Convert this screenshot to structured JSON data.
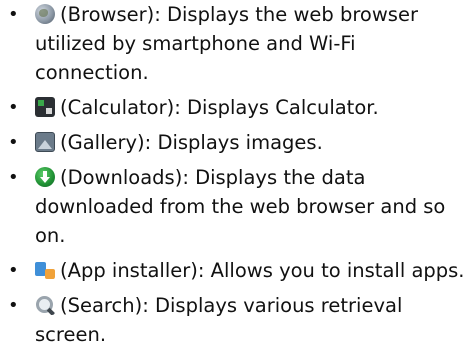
{
  "items": [
    {
      "icon": "browser-icon",
      "name": "(Browser)",
      "desc": ": Displays the web browser utilized by smartphone and Wi-Fi connection."
    },
    {
      "icon": "calculator-icon",
      "name": "(Calculator)",
      "desc": ": Displays Calculator."
    },
    {
      "icon": "gallery-icon",
      "name": "(Gallery)",
      "desc": ": Displays images."
    },
    {
      "icon": "downloads-icon",
      "name": "(Downloads)",
      "desc": ": Displays the data downloaded from the web browser and so on."
    },
    {
      "icon": "app-installer-icon",
      "name": "(App installer)",
      "desc": ": Allows you to install apps."
    },
    {
      "icon": "search-icon",
      "name": "(Search)",
      "desc": ": Displays various retrieval screen."
    }
  ],
  "bullet": "•"
}
